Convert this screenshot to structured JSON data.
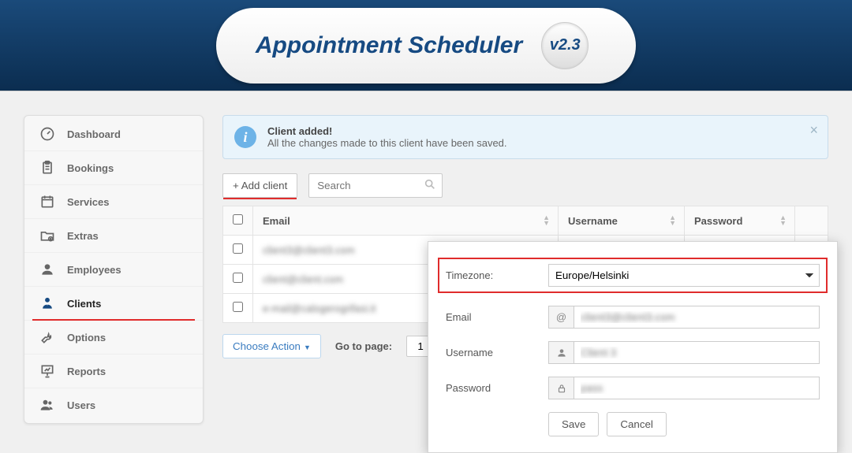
{
  "header": {
    "title": "Appointment Scheduler",
    "version": "v2.3"
  },
  "sidebar": {
    "items": [
      {
        "label": "Dashboard"
      },
      {
        "label": "Bookings"
      },
      {
        "label": "Services"
      },
      {
        "label": "Extras"
      },
      {
        "label": "Employees"
      },
      {
        "label": "Clients"
      },
      {
        "label": "Options"
      },
      {
        "label": "Reports"
      },
      {
        "label": "Users"
      }
    ],
    "active_index": 5
  },
  "alert": {
    "title": "Client added!",
    "body": "All the changes made to this client have been saved."
  },
  "toolbar": {
    "add_client_label": "+ Add client",
    "search_placeholder": "Search"
  },
  "table": {
    "columns": [
      "Email",
      "Username",
      "Password"
    ],
    "rows": [
      {
        "email": "client3@client3.com"
      },
      {
        "email": "client@client.com"
      },
      {
        "email": "e-mail@calogerogrifasi.it"
      }
    ]
  },
  "pager": {
    "choose_action_label": "Choose Action",
    "goto_label": "Go to page:",
    "current_page": "1",
    "page_number": "1"
  },
  "popup": {
    "timezone_label": "Timezone:",
    "timezone_value": "Europe/Helsinki",
    "email_label": "Email",
    "email_value": "client3@client3.com",
    "username_label": "Username",
    "username_value": "Client 3",
    "password_label": "Password",
    "password_value": "pass",
    "save_label": "Save",
    "cancel_label": "Cancel"
  }
}
